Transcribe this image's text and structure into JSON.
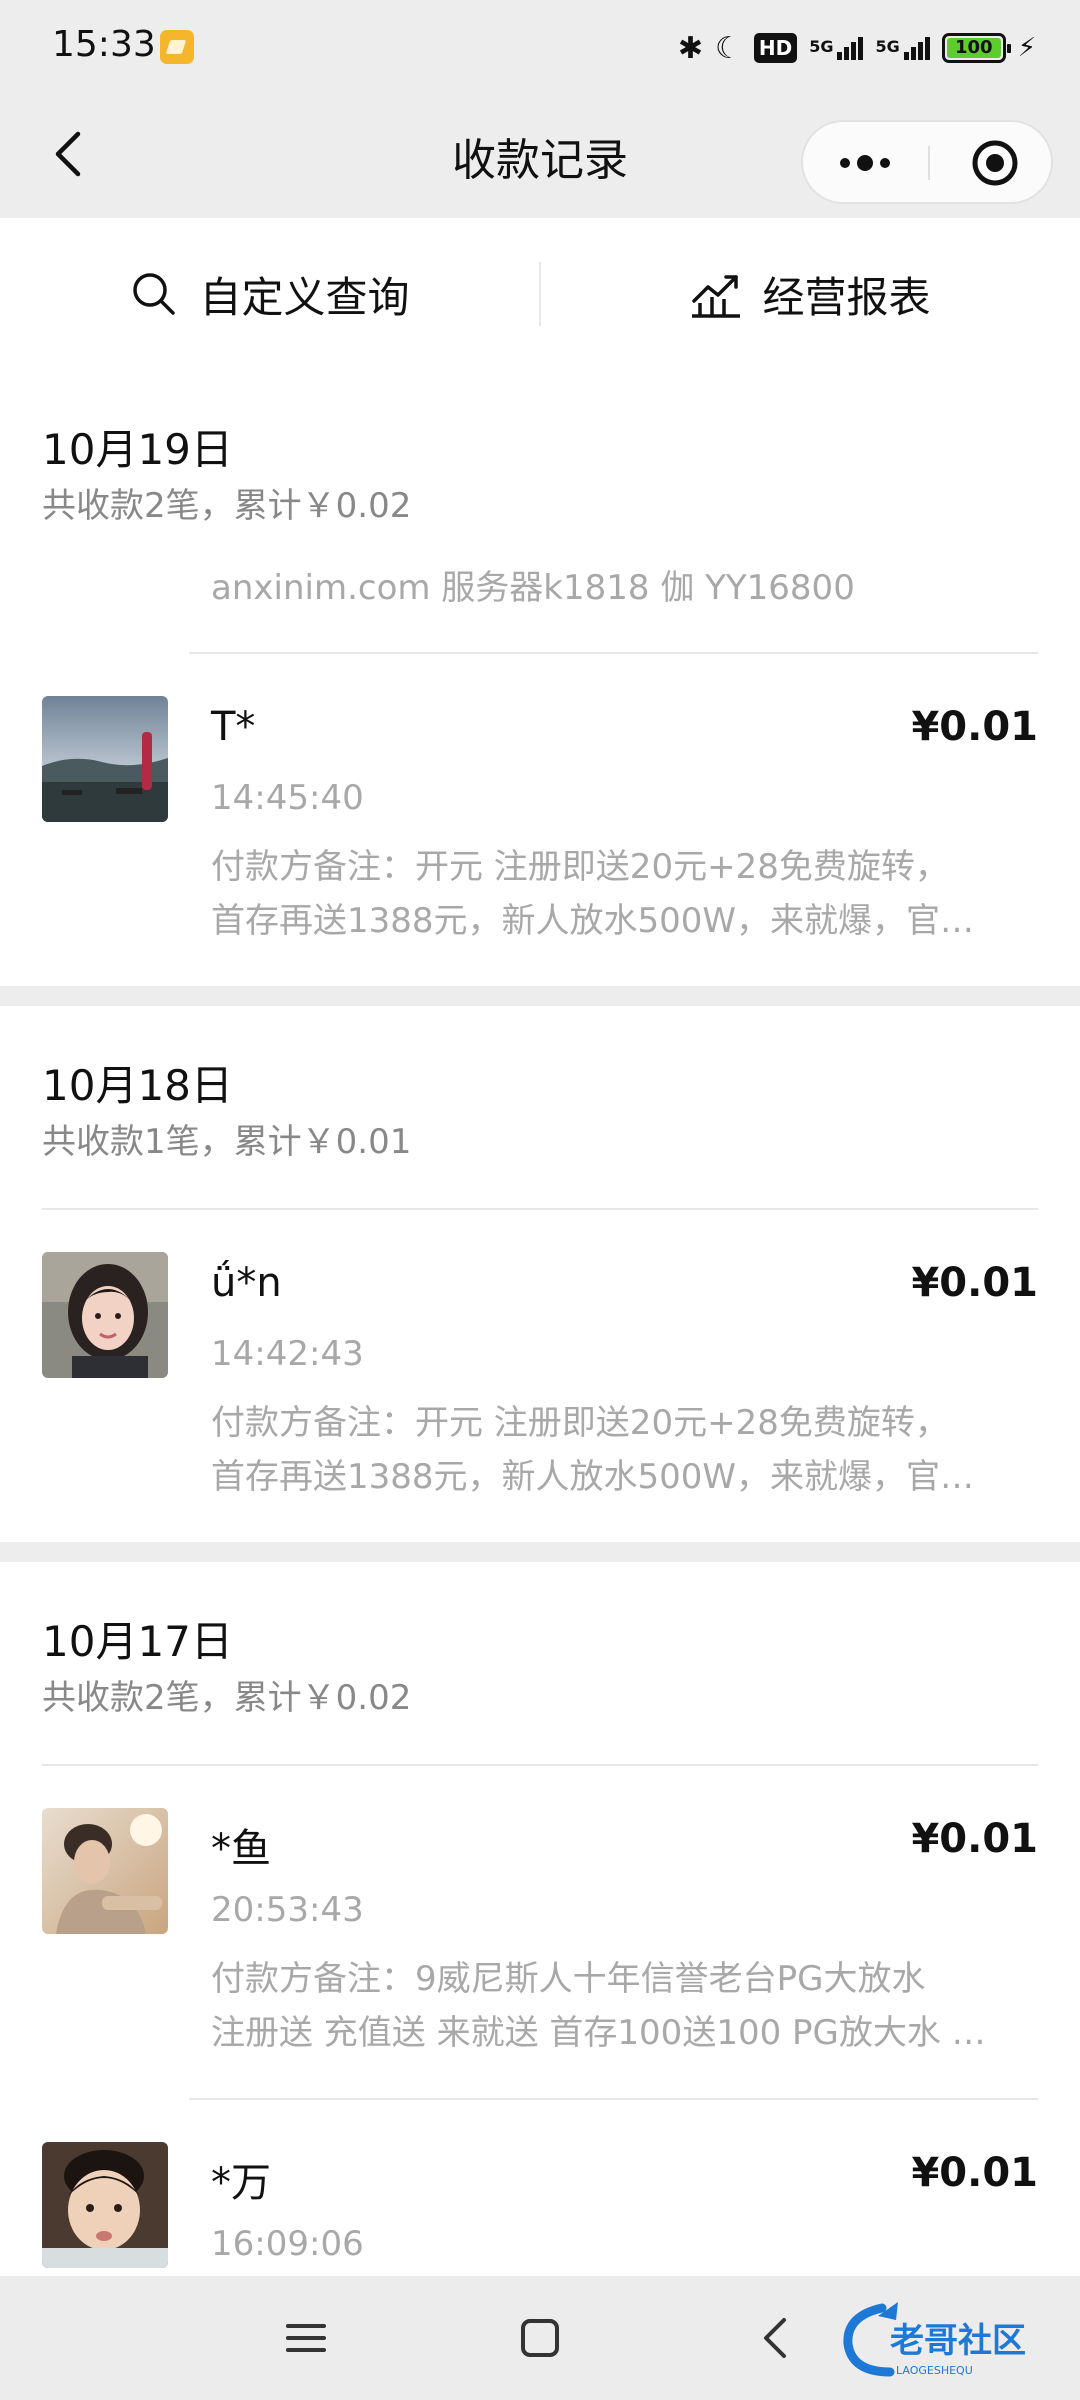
{
  "status_bar": {
    "time": "15:33",
    "net1": "5G",
    "net2": "5G",
    "battery": "100"
  },
  "nav": {
    "title": "收款记录"
  },
  "toolbar": {
    "custom_query": "自定义查询",
    "business_report": "经营报表"
  },
  "days": [
    {
      "date": "10月19日",
      "summary": "共收款2笔，累计￥0.02",
      "notice": "anxinim.com 服务器k1818 伽 YY16800",
      "records": [
        {
          "payer": "T*",
          "amount": "¥0.01",
          "time": "14:45:40",
          "remark_line1": "付款方备注：开元 注册即送20元+28免费旋转，",
          "remark_line2": "首存再送1388元，新人放水500W，来就爆，官…"
        }
      ]
    },
    {
      "date": "10月18日",
      "summary": "共收款1笔，累计￥0.01",
      "records": [
        {
          "payer": "ǘ*n",
          "amount": "¥0.01",
          "time": "14:42:43",
          "remark_line1": "付款方备注：开元 注册即送20元+28免费旋转，",
          "remark_line2": "首存再送1388元，新人放水500W，来就爆，官…"
        }
      ]
    },
    {
      "date": "10月17日",
      "summary": "共收款2笔，累计￥0.02",
      "records": [
        {
          "payer": "*鱼",
          "amount": "¥0.01",
          "time": "20:53:43",
          "remark_line1": "付款方备注：9威尼斯人十年信誉老台PG大放水",
          "remark_line2": "注册送 充值送 来就送 首存100送100 PG放大水 …"
        },
        {
          "payer": "*万",
          "amount": "¥0.01",
          "time": "16:09:06"
        }
      ]
    }
  ],
  "watermark": {
    "text": "老哥社区",
    "subtext": "LAOGESHEQU"
  },
  "icons": {
    "back": "chevron-left-icon",
    "more": "more-dots-icon",
    "close": "target-circle-icon",
    "search": "search-icon",
    "report": "chart-icon"
  }
}
